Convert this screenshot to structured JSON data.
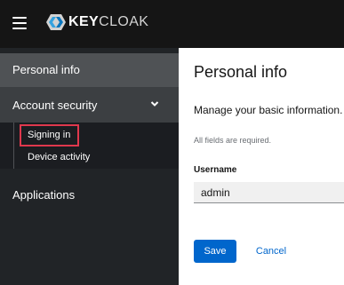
{
  "header": {
    "logo_bold": "KEY",
    "logo_rest": "CLOAK",
    "menu_icon": "hamburger-menu-icon",
    "logo_icon": "keycloak-logo-icon"
  },
  "sidebar": {
    "personal_info": "Personal info",
    "account_security": "Account security",
    "account_security_expanded": true,
    "sub_items": [
      "Signing in",
      "Device activity"
    ],
    "highlighted_item": "Signing in",
    "applications": "Applications"
  },
  "main": {
    "title": "Personal info",
    "subtitle": "Manage your basic information.",
    "required_note": "All fields are required.",
    "username_label": "Username",
    "username_value": "admin",
    "save_label": "Save",
    "cancel_label": "Cancel"
  },
  "colors": {
    "header_bg": "#151515",
    "sidebar_bg": "#212427",
    "active_item_bg": "#4f5255",
    "expanded_item_bg": "#3c3f42",
    "highlight_border": "#e0384d",
    "primary_button": "#0066cc"
  }
}
